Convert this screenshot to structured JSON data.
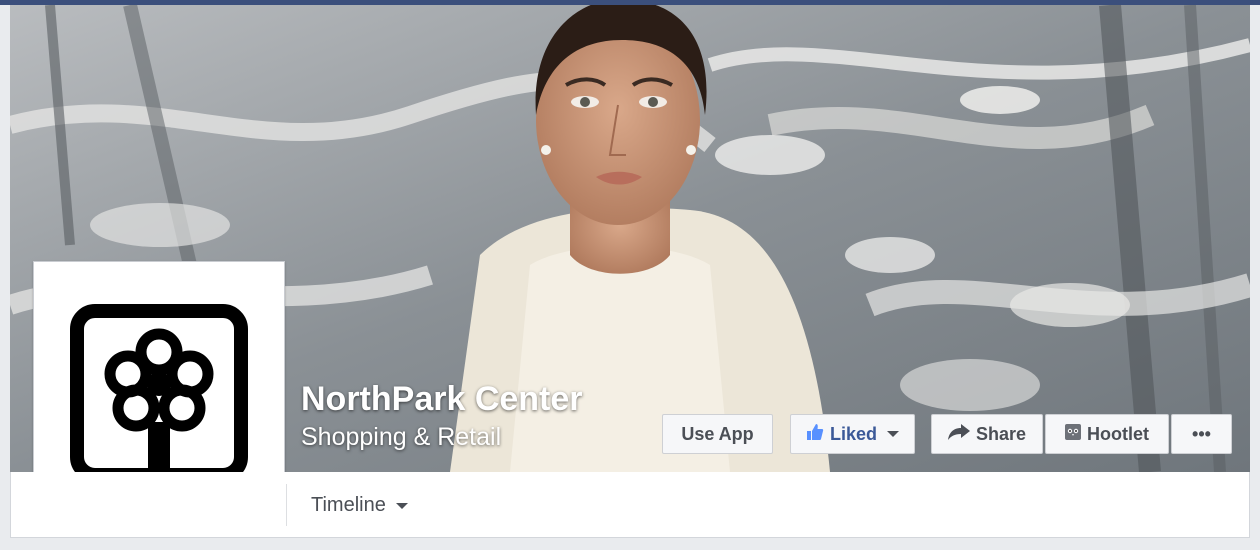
{
  "page": {
    "name": "NorthPark Center",
    "category": "Shopping & Retail"
  },
  "actions": {
    "use_app": "Use App",
    "liked": "Liked",
    "share": "Share",
    "hootlet": "Hootlet",
    "more": "•••"
  },
  "tabs": {
    "timeline": "Timeline"
  },
  "icons": {
    "liked": "thumbs-up-icon",
    "share": "share-arrow-icon",
    "hootlet": "owl-icon",
    "more": "ellipsis-icon",
    "dropdown": "chevron-down-icon"
  },
  "colors": {
    "facebook_blue": "#3b5998",
    "page_background": "#e9ebee",
    "button_text": "#4b4f56"
  }
}
